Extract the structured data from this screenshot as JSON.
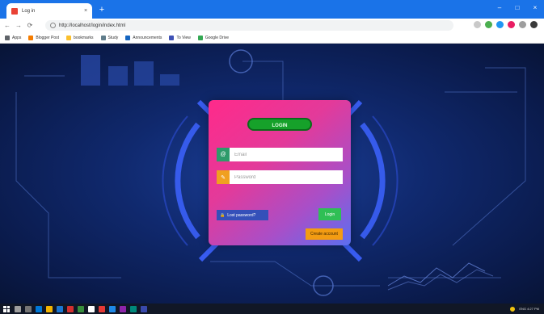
{
  "browser": {
    "tab_title": "Log in",
    "tab_close": "×",
    "new_tab": "+",
    "window_controls": [
      "–",
      "□",
      "×"
    ],
    "nav": {
      "back": "←",
      "forward": "→",
      "reload": "⟳"
    },
    "address": "http://localhost/login/index.html",
    "bookmarks": [
      "Apps",
      "Blogger Post",
      "bookmarks",
      "Study",
      "Announcements",
      "To View",
      "Google Drive"
    ]
  },
  "login": {
    "title": "LOGIN",
    "email_placeholder": "Email",
    "password_placeholder": "Password",
    "email_icon": "@",
    "password_icon": "✎",
    "lost_password_label": "Lost password?",
    "lock_icon": "🔒",
    "login_button": "Login",
    "signup_button": "Create account"
  },
  "taskbar": {
    "tray_text": "ENG  4:27 PM"
  },
  "colors": {
    "browser_accent": "#1a73e8",
    "page_bg": "#10296e",
    "title_pill": "#16a12a",
    "login_green": "#2fbf55",
    "signup_orange": "#f39c12",
    "lost_blue": "#3450b9",
    "email_icon_bg": "#2e9b6a",
    "password_icon_bg": "#f0a020"
  }
}
